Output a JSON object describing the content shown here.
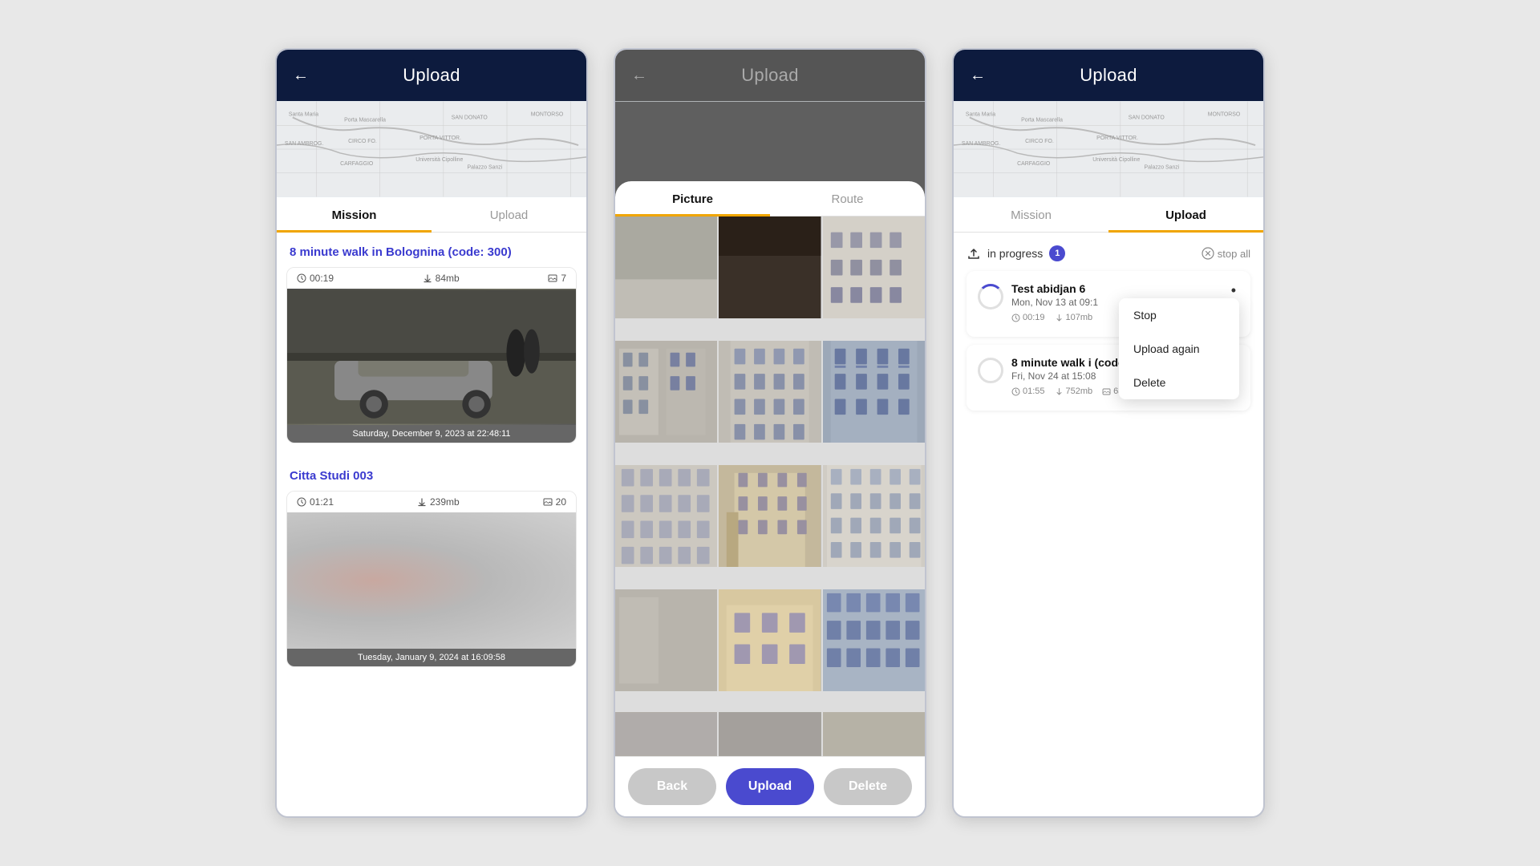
{
  "phone1": {
    "header": {
      "title": "Upload",
      "back_label": "←"
    },
    "tabs": [
      {
        "id": "mission",
        "label": "Mission",
        "active": true
      },
      {
        "id": "upload",
        "label": "Upload",
        "active": false
      }
    ],
    "missions": [
      {
        "title": "8 minute walk in Bolognina (code: 300)",
        "meta": {
          "time": "00:19",
          "size": "84mb",
          "count": "7"
        },
        "timestamp": "Saturday, December 9, 2023 at 22:48:11"
      },
      {
        "title": "Citta Studi 003",
        "meta": {
          "time": "01:21",
          "size": "239mb",
          "count": "20"
        },
        "timestamp": "Tuesday, January 9, 2024 at 16:09:58"
      }
    ]
  },
  "phone2": {
    "header": {
      "title": "Upload",
      "back_label": "←"
    },
    "tabs": [
      {
        "id": "picture",
        "label": "Picture",
        "active": true
      },
      {
        "id": "route",
        "label": "Route",
        "active": false
      }
    ],
    "buttons": {
      "back": "Back",
      "upload": "Upload",
      "delete": "Delete"
    }
  },
  "phone3": {
    "header": {
      "title": "Upload",
      "back_label": "←"
    },
    "tabs": [
      {
        "id": "mission",
        "label": "Mission",
        "active": false
      },
      {
        "id": "upload",
        "label": "Upload",
        "active": true
      }
    ],
    "upload_status": {
      "label": "in progress",
      "count": "1",
      "stop_all": "stop all"
    },
    "items": [
      {
        "name": "Test abidjan 6",
        "date": "Mon, Nov 13 at 09:1",
        "time": "00:19",
        "size": "107mb",
        "uploading": true
      },
      {
        "name": "8 minute walk i",
        "name_cont": "(code: 400)",
        "date": "Fri, Nov 24 at 15:08",
        "time": "01:55",
        "size": "752mb",
        "count": "63",
        "uploading": false
      }
    ],
    "context_menu": {
      "items": [
        {
          "id": "stop",
          "label": "Stop"
        },
        {
          "id": "upload-again",
          "label": "Upload again"
        },
        {
          "id": "delete",
          "label": "Delete"
        }
      ]
    }
  }
}
